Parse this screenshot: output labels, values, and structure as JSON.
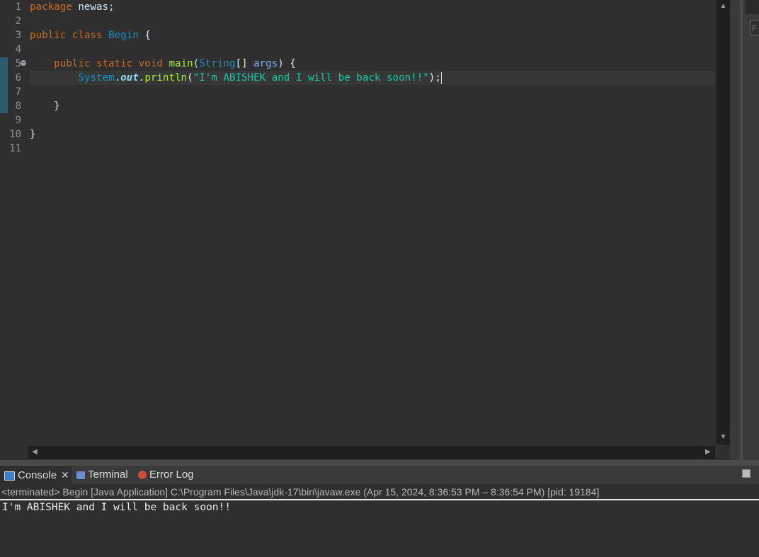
{
  "editor": {
    "line_numbers": [
      "1",
      "2",
      "3",
      "4",
      "5",
      "6",
      "7",
      "8",
      "9",
      "10",
      "11"
    ],
    "lines": [
      [
        {
          "c": "kw",
          "t": "package"
        },
        {
          "c": "plain",
          "t": " newas;"
        }
      ],
      [],
      [
        {
          "c": "kw",
          "t": "public"
        },
        {
          "c": "plain",
          "t": " "
        },
        {
          "c": "kw",
          "t": "class"
        },
        {
          "c": "plain",
          "t": " "
        },
        {
          "c": "cls",
          "t": "Begin"
        },
        {
          "c": "plain",
          "t": " {"
        }
      ],
      [],
      [
        {
          "c": "plain",
          "t": "    "
        },
        {
          "c": "kw",
          "t": "public"
        },
        {
          "c": "plain",
          "t": " "
        },
        {
          "c": "kw",
          "t": "static"
        },
        {
          "c": "plain",
          "t": " "
        },
        {
          "c": "kw",
          "t": "void"
        },
        {
          "c": "plain",
          "t": " "
        },
        {
          "c": "meth",
          "t": "main"
        },
        {
          "c": "plain",
          "t": "("
        },
        {
          "c": "typ",
          "t": "String"
        },
        {
          "c": "plain",
          "t": "[] "
        },
        {
          "c": "param",
          "t": "args"
        },
        {
          "c": "plain",
          "t": ") {"
        }
      ],
      [
        {
          "c": "plain",
          "t": "        "
        },
        {
          "c": "cls",
          "t": "System"
        },
        {
          "c": "plain",
          "t": "."
        },
        {
          "c": "static-field",
          "t": "out"
        },
        {
          "c": "plain",
          "t": "."
        },
        {
          "c": "meth",
          "t": "println"
        },
        {
          "c": "plain",
          "t": "("
        },
        {
          "c": "str",
          "t": "\"I'm ABISHEK and I will be back soon!!\""
        },
        {
          "c": "plain",
          "t": ");"
        }
      ],
      [],
      [
        {
          "c": "plain",
          "t": "    }"
        }
      ],
      [],
      [
        {
          "c": "plain",
          "t": "}"
        }
      ],
      []
    ],
    "current_line": 5
  },
  "right_panel": {
    "field_char": "F"
  },
  "bottom_panel": {
    "tabs": [
      {
        "label": "Console",
        "icon": "console-icon",
        "active": true,
        "closable": true,
        "icon_color": "#3c7fcf"
      },
      {
        "label": "Terminal",
        "icon": "terminal-icon",
        "active": false,
        "closable": false,
        "icon_color": "#6a8fd0"
      },
      {
        "label": "Error Log",
        "icon": "error-log-icon",
        "active": false,
        "closable": false,
        "icon_color": "#d04a3a"
      }
    ],
    "close_glyph": "✕",
    "status": "<terminated> Begin [Java Application] C:\\Program Files\\Java\\jdk-17\\bin\\javaw.exe  (Apr 15, 2024, 8:36:53 PM – 8:36:54 PM) [pid: 19184]",
    "output": "I'm ABISHEK and I will be back soon!!"
  },
  "colors": {
    "background": "#2f2f2f",
    "keyword": "#cc6c1d",
    "string": "#17c6a3",
    "method": "#a7ec21",
    "type": "#1290c3"
  }
}
